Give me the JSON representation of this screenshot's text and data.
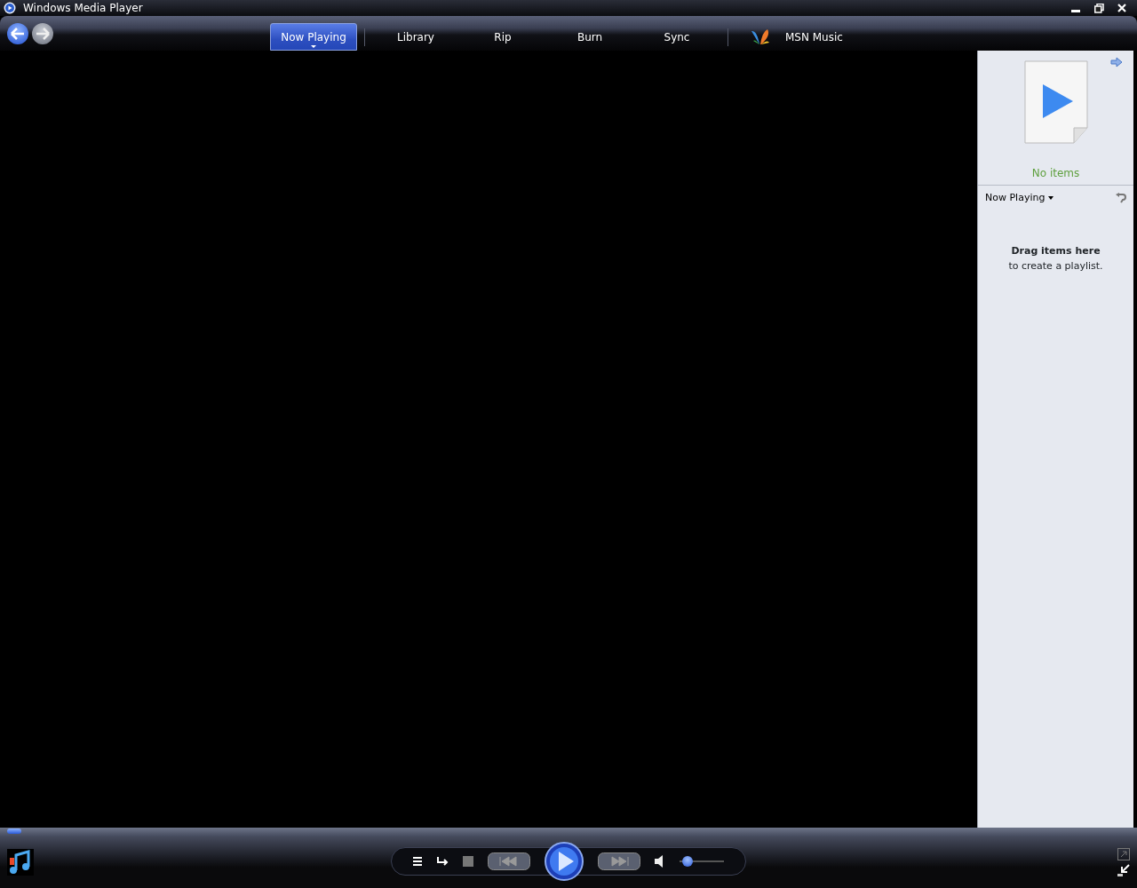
{
  "window": {
    "title": "Windows Media Player"
  },
  "tabs": [
    {
      "label": "Now Playing",
      "selected": true,
      "kind": "text"
    },
    {
      "label": "Library",
      "selected": false,
      "kind": "text"
    },
    {
      "label": "Rip",
      "selected": false,
      "kind": "text"
    },
    {
      "label": "Burn",
      "selected": false,
      "kind": "text"
    },
    {
      "label": "Sync",
      "selected": false,
      "kind": "text"
    },
    {
      "label": "MSN Music",
      "selected": false,
      "kind": "logo"
    }
  ],
  "list_pane": {
    "status": "No items",
    "list_title": "Now Playing",
    "hint_title": "Drag items here",
    "hint_text": "to create a playlist."
  },
  "seek": {
    "level": 0
  },
  "volume": {
    "level": 0.08
  }
}
